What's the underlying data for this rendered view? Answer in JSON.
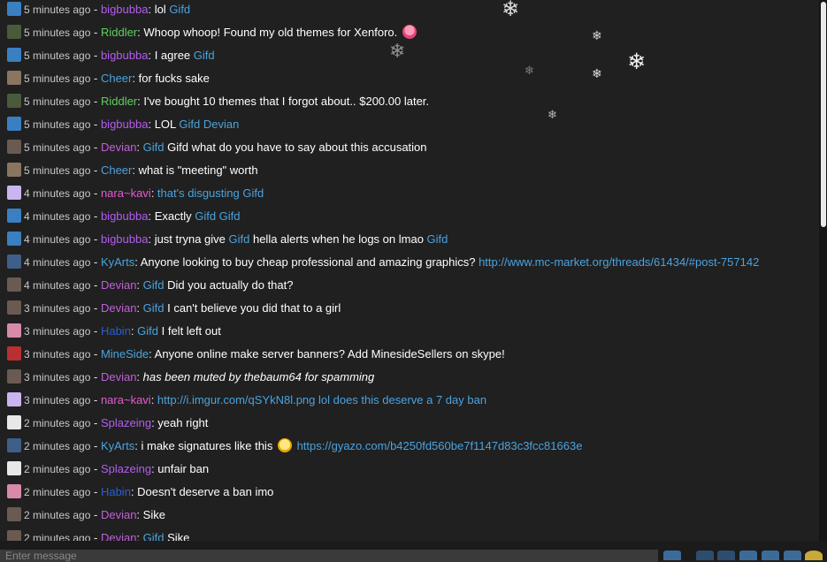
{
  "chat": {
    "messages": [
      {
        "time": "5 minutes ago",
        "user": "bigbubba",
        "user_color": "#b45cf0",
        "avatar_color": "#3a7fc1",
        "parts": [
          {
            "text": "lol ",
            "type": "text"
          },
          {
            "text": "Gifd",
            "type": "link"
          }
        ]
      },
      {
        "time": "5 minutes ago",
        "user": "Riddler",
        "user_color": "#5fd05f",
        "avatar_color": "#4a5a3a",
        "parts": [
          {
            "text": "Whoop whoop! Found my old themes for Xenforo.",
            "type": "text"
          }
        ],
        "emoji": "tongue"
      },
      {
        "time": "5 minutes ago",
        "user": "bigbubba",
        "user_color": "#b45cf0",
        "avatar_color": "#3a7fc1",
        "parts": [
          {
            "text": "I agree ",
            "type": "text"
          },
          {
            "text": "Gifd",
            "type": "link"
          }
        ]
      },
      {
        "time": "5 minutes ago",
        "user": "Cheer",
        "user_color": "#4aa3df",
        "avatar_color": "#8a7560",
        "parts": [
          {
            "text": "for fucks sake",
            "type": "text"
          }
        ]
      },
      {
        "time": "5 minutes ago",
        "user": "Riddler",
        "user_color": "#5fd05f",
        "avatar_color": "#4a5a3a",
        "parts": [
          {
            "text": "I've bought 10 themes that I forgot about.. $200.00 later.",
            "type": "text"
          }
        ]
      },
      {
        "time": "5 minutes ago",
        "user": "bigbubba",
        "user_color": "#b45cf0",
        "avatar_color": "#3a7fc1",
        "parts": [
          {
            "text": "LOL ",
            "type": "text"
          },
          {
            "text": "Gifd Devian",
            "type": "link"
          }
        ]
      },
      {
        "time": "5 minutes ago",
        "user": "Devian",
        "user_color": "#c25fd8",
        "avatar_color": "#6a5a52",
        "parts": [
          {
            "text": "Gifd",
            "type": "link"
          },
          {
            "text": " Gifd what do you have to say about this accusation",
            "type": "text"
          }
        ]
      },
      {
        "time": "5 minutes ago",
        "user": "Cheer",
        "user_color": "#4aa3df",
        "avatar_color": "#8a7560",
        "parts": [
          {
            "text": "what is \"meeting\" worth",
            "type": "text"
          }
        ]
      },
      {
        "time": "4 minutes ago",
        "user": "nara~kavi",
        "user_color": "#e65ad2",
        "avatar_color": "#c9b6f0",
        "parts": [
          {
            "text": "that's disgusting Gifd",
            "type": "link"
          }
        ]
      },
      {
        "time": "4 minutes ago",
        "user": "bigbubba",
        "user_color": "#b45cf0",
        "avatar_color": "#3a7fc1",
        "parts": [
          {
            "text": "Exactly ",
            "type": "text"
          },
          {
            "text": "Gifd Gifd",
            "type": "link"
          }
        ]
      },
      {
        "time": "4 minutes ago",
        "user": "bigbubba",
        "user_color": "#b45cf0",
        "avatar_color": "#3a7fc1",
        "parts": [
          {
            "text": "just tryna give ",
            "type": "text"
          },
          {
            "text": "Gifd",
            "type": "link"
          },
          {
            "text": " hella alerts when he logs on lmao ",
            "type": "text"
          },
          {
            "text": "Gifd",
            "type": "link"
          }
        ]
      },
      {
        "time": "4 minutes ago",
        "user": "KyArts",
        "user_color": "#4aa3df",
        "avatar_color": "#3d5f88",
        "parts": [
          {
            "text": "Anyone looking to buy cheap professional and amazing graphics? ",
            "type": "text"
          },
          {
            "text": "http://www.mc-market.org/threads/61434/#post-757142",
            "type": "link"
          }
        ]
      },
      {
        "time": "4 minutes ago",
        "user": "Devian",
        "user_color": "#c25fd8",
        "avatar_color": "#6a5a52",
        "parts": [
          {
            "text": "Gifd",
            "type": "link"
          },
          {
            "text": " Did you actually do that?",
            "type": "text"
          }
        ]
      },
      {
        "time": "3 minutes ago",
        "user": "Devian",
        "user_color": "#c25fd8",
        "avatar_color": "#6a5a52",
        "parts": [
          {
            "text": "Gifd",
            "type": "link"
          },
          {
            "text": " I can't believe you did that to a girl",
            "type": "text"
          }
        ]
      },
      {
        "time": "3 minutes ago",
        "user": "Habin",
        "user_color": "#2a5fd0",
        "avatar_color": "#d88aa8",
        "parts": [
          {
            "text": "Gifd",
            "type": "link"
          },
          {
            "text": " I felt left out",
            "type": "text"
          }
        ]
      },
      {
        "time": "3 minutes ago",
        "user": "MineSide",
        "user_color": "#4aa3df",
        "avatar_color": "#b83030",
        "parts": [
          {
            "text": "Anyone online make server banners? Add MinesideSellers on skype!",
            "type": "text"
          }
        ]
      },
      {
        "time": "3 minutes ago",
        "user": "Devian",
        "user_color": "#c25fd8",
        "avatar_color": "#6a5a52",
        "parts": [
          {
            "text": "has been muted by thebaum64 for spamming",
            "type": "italic"
          }
        ]
      },
      {
        "time": "3 minutes ago",
        "user": "nara~kavi",
        "user_color": "#e65ad2",
        "avatar_color": "#c9b6f0",
        "parts": [
          {
            "text": "http://i.imgur.com/qSYkN8l.png lol does this deserve a 7 day ban",
            "type": "link"
          }
        ]
      },
      {
        "time": "2 minutes ago",
        "user": "Splazeing",
        "user_color": "#b45cf0",
        "avatar_color": "#e8e8e8",
        "parts": [
          {
            "text": "yeah right",
            "type": "text"
          }
        ]
      },
      {
        "time": "2 minutes ago",
        "user": "KyArts",
        "user_color": "#4aa3df",
        "avatar_color": "#3d5f88",
        "parts": [
          {
            "text": "i make signatures like this",
            "type": "text"
          }
        ],
        "emoji": "smile",
        "after": [
          {
            "text": "https://gyazo.com/b4250fd560be7f1147d83c3fcc81663e",
            "type": "link"
          }
        ]
      },
      {
        "time": "2 minutes ago",
        "user": "Splazeing",
        "user_color": "#b45cf0",
        "avatar_color": "#e8e8e8",
        "parts": [
          {
            "text": "unfair ban",
            "type": "text"
          }
        ]
      },
      {
        "time": "2 minutes ago",
        "user": "Habin",
        "user_color": "#2a5fd0",
        "avatar_color": "#d88aa8",
        "parts": [
          {
            "text": "Doesn't deserve a ban imo",
            "type": "text"
          }
        ]
      },
      {
        "time": "2 minutes ago",
        "user": "Devian",
        "user_color": "#c25fd8",
        "avatar_color": "#6a5a52",
        "parts": [
          {
            "text": "Sike",
            "type": "text"
          }
        ]
      },
      {
        "time": "2 minutes ago",
        "user": "Devian",
        "user_color": "#c25fd8",
        "avatar_color": "#6a5a52",
        "parts": [
          {
            "text": "Gifd",
            "type": "link"
          },
          {
            "text": " Sike",
            "type": "text"
          }
        ]
      }
    ]
  },
  "input": {
    "placeholder": "Enter message"
  },
  "decor": {
    "flake_glyph": "❄"
  }
}
